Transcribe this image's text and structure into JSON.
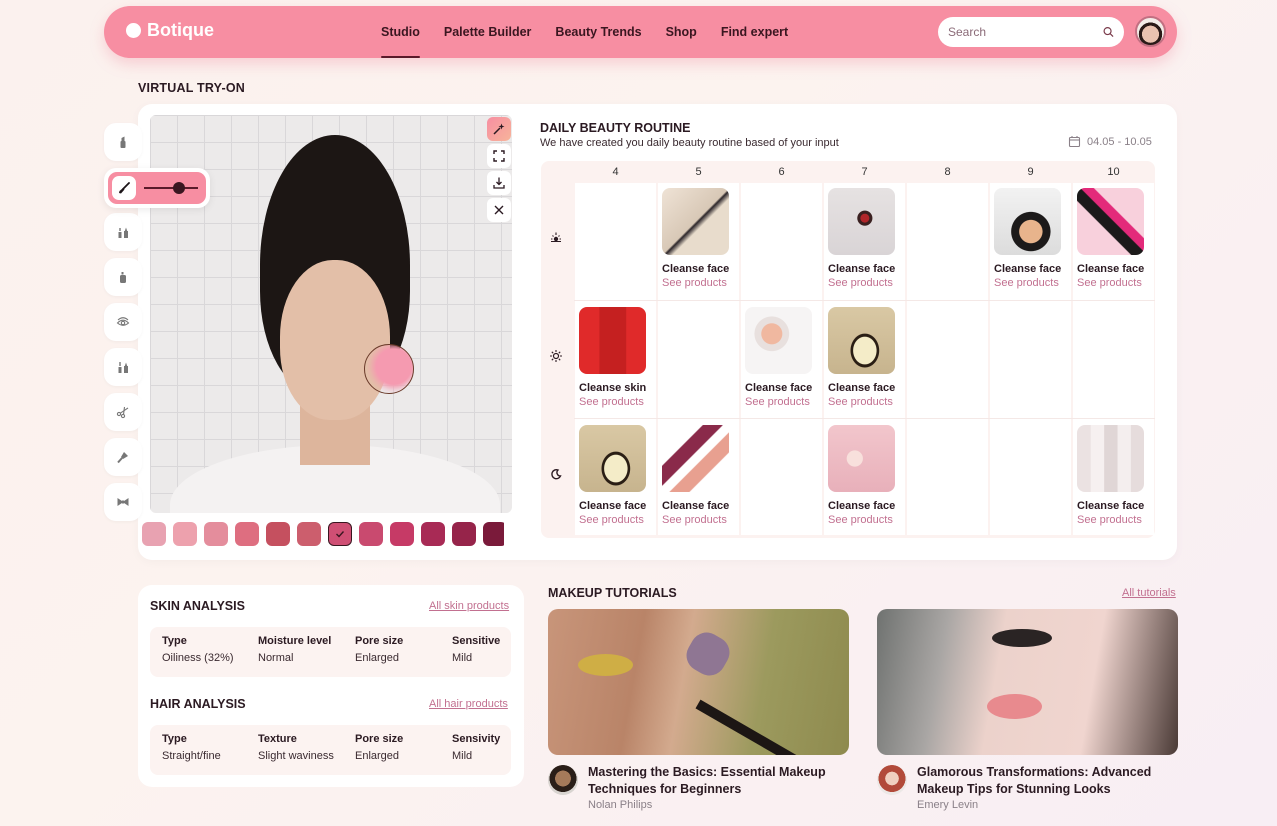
{
  "app": {
    "brand": "Botique"
  },
  "nav": {
    "items": [
      {
        "label": "Studio",
        "active": true
      },
      {
        "label": "Palette Builder",
        "active": false
      },
      {
        "label": "Beauty Trends",
        "active": false
      },
      {
        "label": "Shop",
        "active": false
      },
      {
        "label": "Find expert",
        "active": false
      }
    ],
    "search_placeholder": "Search"
  },
  "colors": {
    "accent": "#f78ea2",
    "dark": "#3a1620",
    "link": "#c27090"
  },
  "virtual_tryon": {
    "title": "VIRTUAL TRY-ON",
    "tools": [
      "lipstick-icon",
      "brush-icon",
      "lip-liner-icon",
      "foundation-icon",
      "eye-icon",
      "mascara-icon",
      "scissors-icon",
      "hairbrush-icon",
      "bow-icon"
    ],
    "brush_intensity": 0.75,
    "photo_tools": [
      "magic-wand-icon",
      "fullscreen-icon",
      "download-icon",
      "close-icon"
    ],
    "swatches": [
      "#e8a2b1",
      "#eda1ad",
      "#e48d9c",
      "#de6e80",
      "#c5505f",
      "#cc5e6d",
      "#cf4f74",
      "#c94a6f",
      "#c63a66",
      "#a82a55",
      "#96244a",
      "#7a1a3a",
      "#7a1a3a"
    ],
    "selected_swatch": 6
  },
  "routine": {
    "title": "DAILY BEAUTY ROUTINE",
    "subtitle": "We have created you daily beauty routine based of your input",
    "date_range": "04.05 - 10.05",
    "days": [
      "4",
      "5",
      "6",
      "7",
      "8",
      "9",
      "10"
    ],
    "rows": [
      "sunrise-icon",
      "sun-icon",
      "moon-icon"
    ],
    "items": [
      {
        "row": 0,
        "col": 1,
        "label": "Cleanse face",
        "link": "See products",
        "thumb": "powder-brushes"
      },
      {
        "row": 0,
        "col": 3,
        "label": "Cleanse face",
        "link": "See products",
        "thumb": "red-lipstick"
      },
      {
        "row": 0,
        "col": 5,
        "label": "Cleanse face",
        "link": "See products",
        "thumb": "compact-powder"
      },
      {
        "row": 0,
        "col": 6,
        "label": "Cleanse face",
        "link": "See products",
        "thumb": "pink-lipstick"
      },
      {
        "row": 1,
        "col": 0,
        "label": "Cleanse skin",
        "link": "See products",
        "thumb": "red-lipstick-box"
      },
      {
        "row": 1,
        "col": 2,
        "label": "Cleanse face",
        "link": "See products",
        "thumb": "cream-brush"
      },
      {
        "row": 1,
        "col": 3,
        "label": "Cleanse face",
        "link": "See products",
        "thumb": "gold-compact"
      },
      {
        "row": 2,
        "col": 0,
        "label": "Cleanse face",
        "link": "See products",
        "thumb": "gold-compact"
      },
      {
        "row": 2,
        "col": 1,
        "label": "Cleanse face",
        "link": "See products",
        "thumb": "eyeshadow-palettes"
      },
      {
        "row": 2,
        "col": 3,
        "label": "Cleanse face",
        "link": "See products",
        "thumb": "hands-pink"
      },
      {
        "row": 2,
        "col": 6,
        "label": "Cleanse face",
        "link": "See products",
        "thumb": "skincare-set"
      }
    ]
  },
  "skin_analysis": {
    "title": "SKIN ANALYSIS",
    "link": "All skin products",
    "fields": [
      {
        "key": "Type",
        "value": "Oiliness (32%)"
      },
      {
        "key": "Moisture level",
        "value": "Normal"
      },
      {
        "key": "Pore size",
        "value": "Enlarged"
      },
      {
        "key": "Sensitive",
        "value": "Mild"
      }
    ]
  },
  "hair_analysis": {
    "title": "HAIR ANALYSIS",
    "link": "All hair products",
    "fields": [
      {
        "key": "Type",
        "value": "Straight/fine"
      },
      {
        "key": "Texture",
        "value": "Slight waviness"
      },
      {
        "key": "Pore size",
        "value": "Enlarged"
      },
      {
        "key": "Sensivity",
        "value": "Mild"
      }
    ]
  },
  "tutorials": {
    "title": "MAKEUP TUTORIALS",
    "link": "All tutorials",
    "items": [
      {
        "title": "Mastering the Basics: Essential Makeup Techniques for Beginners",
        "author": "Nolan Philips"
      },
      {
        "title": "Glamorous Transformations: Advanced Makeup Tips for Stunning Looks",
        "author": "Emery Levin"
      }
    ]
  }
}
